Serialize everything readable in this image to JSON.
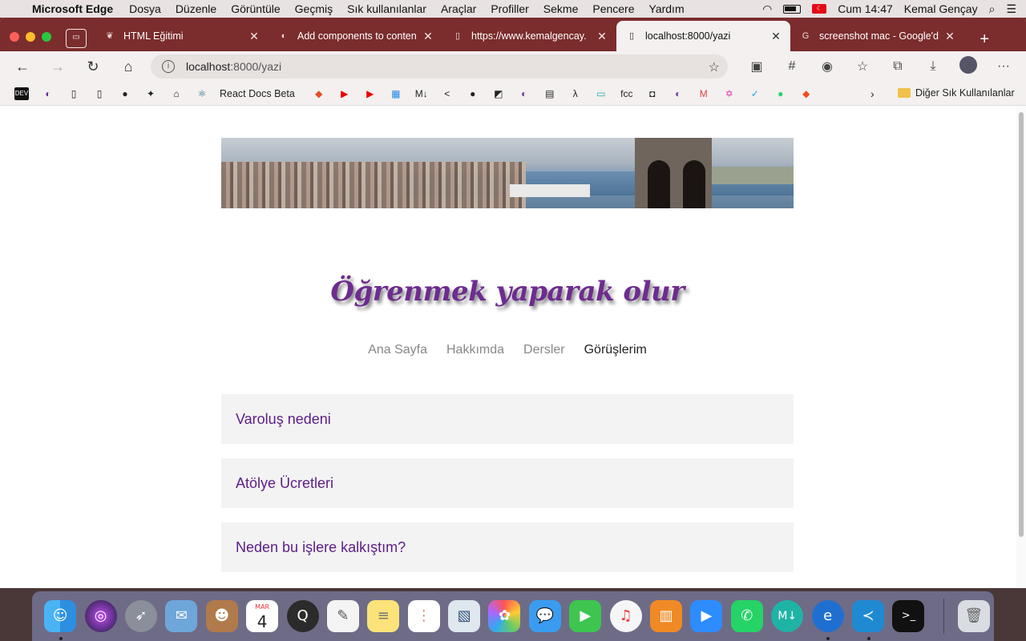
{
  "menubar": {
    "apple_icon": "apple-icon",
    "app_name": "Microsoft Edge",
    "items": [
      "Dosya",
      "Düzenle",
      "Görüntüle",
      "Geçmiş",
      "Sık kullanılanlar",
      "Araçlar",
      "Profiller",
      "Sekme",
      "Pencere",
      "Yardım"
    ],
    "clock": "Cum 14:47",
    "user": "Kemal Gençay"
  },
  "tabs": [
    {
      "title": "HTML Eğitimi",
      "icon": "leaf-icon",
      "active": false
    },
    {
      "title": "Add components to conten",
      "icon": "gatsby-icon",
      "active": false
    },
    {
      "title": "https://www.kemalgencay.",
      "icon": "page-icon",
      "active": false
    },
    {
      "title": "localhost:8000/yazi",
      "icon": "page-icon",
      "active": true
    },
    {
      "title": "screenshot mac - Google'd",
      "icon": "google-icon",
      "active": false
    }
  ],
  "address": {
    "url_host": "localhost",
    "url_rest": ":8000/yazi"
  },
  "bookmarks": {
    "react_docs": "React Docs Beta",
    "other_folder": "Diğer Sık Kullanılanlar",
    "dev_label": "DEV"
  },
  "site": {
    "title": "Öğrenmek yaparak olur",
    "nav": [
      {
        "label": "Ana Sayfa",
        "active": false
      },
      {
        "label": "Hakkımda",
        "active": false
      },
      {
        "label": "Dersler",
        "active": false
      },
      {
        "label": "Görüşlerim",
        "active": true
      }
    ],
    "posts": [
      {
        "title": "Varoluş nedeni"
      },
      {
        "title": "Atölye Ücretleri"
      },
      {
        "title": "Neden bu işlere kalkıştım?"
      }
    ]
  },
  "dock": {
    "calendar_month": "MAR",
    "calendar_day": "4",
    "apps": [
      "Finder",
      "Siri",
      "Launchpad",
      "Mail",
      "Contacts",
      "Calendar",
      "QuickTime",
      "TextEdit",
      "Notes",
      "Reminders",
      "Preview",
      "Photos",
      "Messages",
      "FaceTime",
      "iTunes",
      "Books",
      "Zoom",
      "WhatsApp",
      "Markdown",
      "Edge",
      "VS Code",
      "Terminal",
      "Trash"
    ]
  }
}
